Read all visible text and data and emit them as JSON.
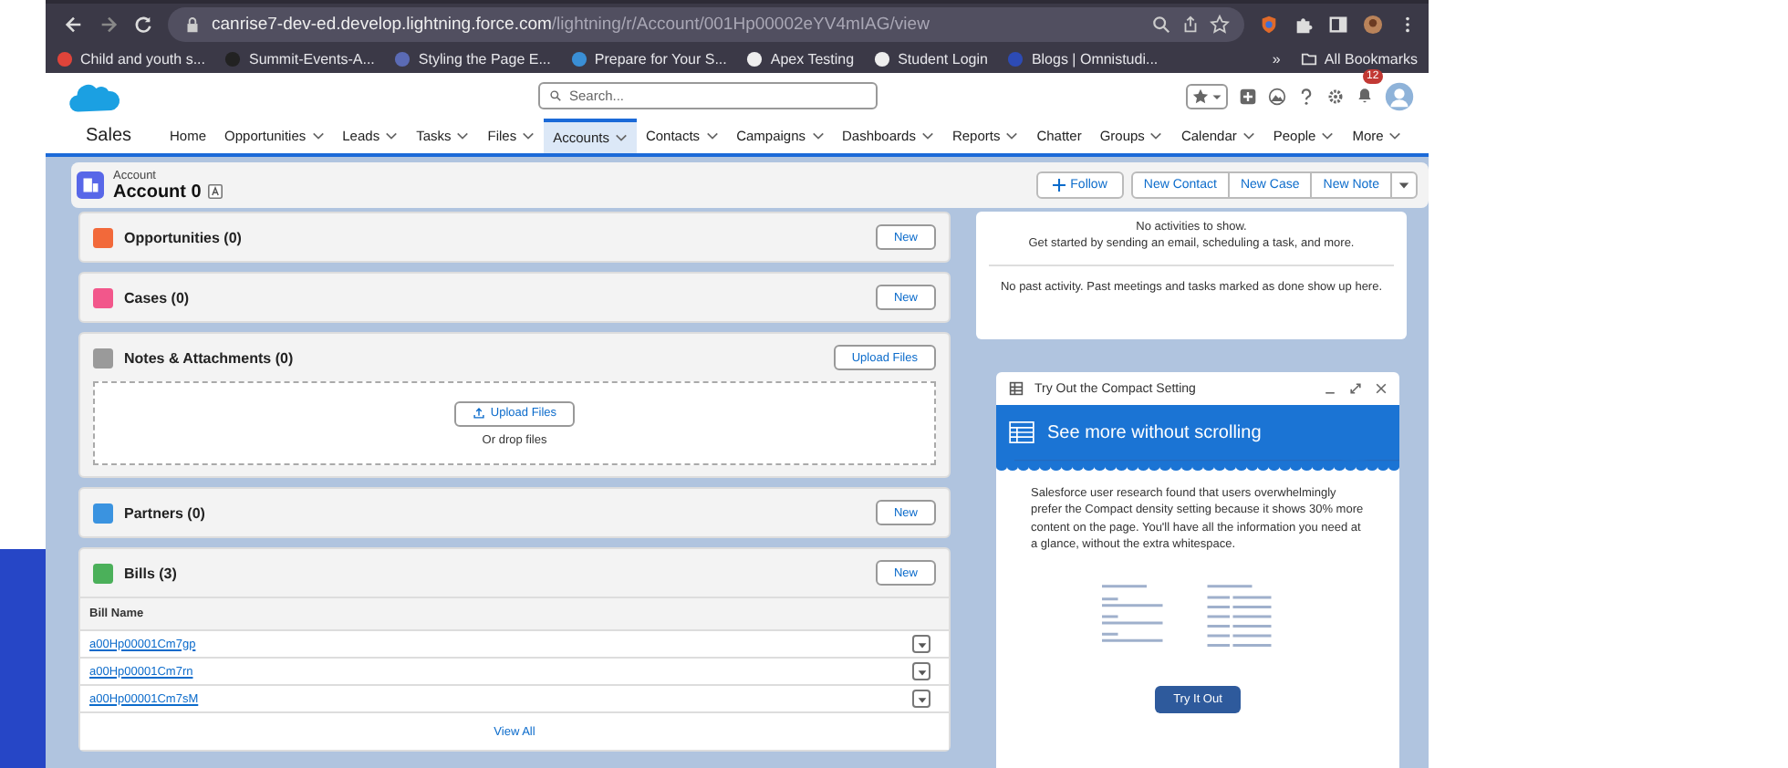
{
  "browser": {
    "url_domain": "canrise7-dev-ed.develop.lightning.force.com",
    "url_path": "/lightning/r/Account/001Hp00002eYV4mIAG/view",
    "bookmarks": [
      {
        "label": "Child and youth s...",
        "color": "#e0443a"
      },
      {
        "label": "Summit-Events-A...",
        "color": "#222222"
      },
      {
        "label": "Styling the Page E...",
        "color": "#5b6bb5"
      },
      {
        "label": "Prepare for Your S...",
        "color": "#3a8fd6"
      },
      {
        "label": "Apex Testing",
        "color": "#eeeeee"
      },
      {
        "label": "Student Login",
        "color": "#eeeeee"
      },
      {
        "label": "Blogs | Omnistudi...",
        "color": "#2d4bb5"
      }
    ],
    "more": "»",
    "all_bookmarks": "All Bookmarks"
  },
  "header": {
    "search_placeholder": "Search...",
    "notification_count": "12"
  },
  "nav": {
    "app_name": "Sales",
    "items": [
      {
        "label": "Home",
        "menu": false,
        "selected": false
      },
      {
        "label": "Opportunities",
        "menu": true,
        "selected": false
      },
      {
        "label": "Leads",
        "menu": true,
        "selected": false
      },
      {
        "label": "Tasks",
        "menu": true,
        "selected": false
      },
      {
        "label": "Files",
        "menu": true,
        "selected": false
      },
      {
        "label": "Accounts",
        "menu": true,
        "selected": true
      },
      {
        "label": "Contacts",
        "menu": true,
        "selected": false
      },
      {
        "label": "Campaigns",
        "menu": true,
        "selected": false
      },
      {
        "label": "Dashboards",
        "menu": true,
        "selected": false
      },
      {
        "label": "Reports",
        "menu": true,
        "selected": false
      },
      {
        "label": "Chatter",
        "menu": false,
        "selected": false
      },
      {
        "label": "Groups",
        "menu": true,
        "selected": false
      },
      {
        "label": "Calendar",
        "menu": true,
        "selected": false
      },
      {
        "label": "People",
        "menu": true,
        "selected": false
      },
      {
        "label": "More",
        "menu": true,
        "selected": false
      }
    ]
  },
  "record": {
    "type": "Account",
    "name": "Account 0",
    "actions": [
      "Follow",
      "New Contact",
      "New Case",
      "New Note"
    ]
  },
  "related_lists": [
    {
      "title": "Opportunities (0)",
      "color": "#f2693a",
      "button": "New",
      "kind": "empty"
    },
    {
      "title": "Cases (0)",
      "color": "#f2578b",
      "button": "New",
      "kind": "empty"
    },
    {
      "title": "Notes & Attachments (0)",
      "color": "#9a9a9a",
      "button": "Upload Files",
      "kind": "files",
      "upload": "Upload Files",
      "drop": "Or drop files"
    },
    {
      "title": "Partners (0)",
      "color": "#3a93e0",
      "button": "New",
      "kind": "empty"
    },
    {
      "title": "Bills (3)",
      "color": "#4bb05a",
      "button": "New",
      "kind": "table",
      "column": "Bill Name",
      "rows": [
        "a00Hp00001Cm7gp",
        "a00Hp00001Cm7rn",
        "a00Hp00001Cm7sM"
      ],
      "footer": "View All"
    }
  ],
  "activity": {
    "upcoming": [
      "No activities to show.",
      "Get started by sending an email, scheduling a task, and more."
    ],
    "past": "No past activity. Past meetings and tasks marked as done show up here."
  },
  "prompt": {
    "title": "Try Out the Compact Setting",
    "banner": "See more without scrolling",
    "body": "Salesforce user research found that users overwhelmingly prefer the Compact density setting because it shows 30% more content on the page. You'll have all the information you need at a glance, without the extra whitespace.",
    "button": "Try It Out"
  }
}
